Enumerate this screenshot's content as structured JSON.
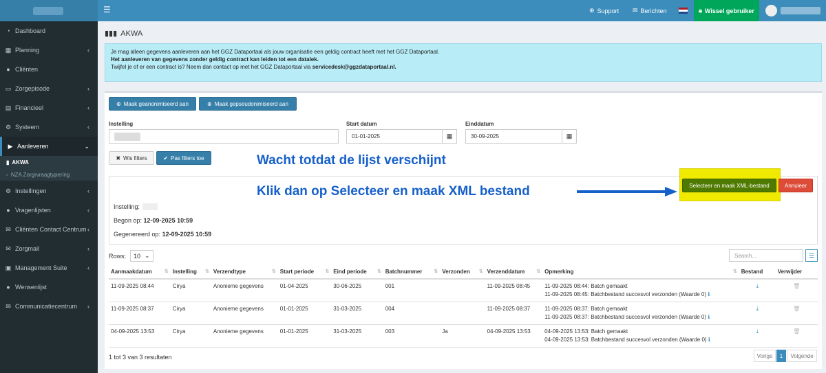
{
  "topbar": {
    "support": "Support",
    "messages": "Berichten",
    "switch_user": "Wissel gebruiker"
  },
  "sidebar": {
    "items": [
      {
        "label": "Dashboard",
        "icon": "dashboard-icon",
        "glyph": "◔"
      },
      {
        "label": "Planning",
        "icon": "calendar-icon",
        "glyph": "▦"
      },
      {
        "label": "Cliënten",
        "icon": "user-icon",
        "glyph": "●"
      },
      {
        "label": "Zorgepisode",
        "icon": "folder-icon",
        "glyph": "▭"
      },
      {
        "label": "Financieel",
        "icon": "money-icon",
        "glyph": "▤"
      },
      {
        "label": "Systeem",
        "icon": "gear-icon",
        "glyph": "⚙"
      },
      {
        "label": "Aanleveren",
        "icon": "truck-icon",
        "glyph": "▶"
      },
      {
        "label": "Instellingen",
        "icon": "cog-icon",
        "glyph": "⚙"
      },
      {
        "label": "Vragenlijsten",
        "icon": "comments-icon",
        "glyph": "●"
      },
      {
        "label": "Cliënten Contact Centrum",
        "icon": "envelope-icon",
        "glyph": "✉"
      },
      {
        "label": "Zorgmail",
        "icon": "mail-icon",
        "glyph": "✉"
      },
      {
        "label": "Management Suite",
        "icon": "briefcase-icon",
        "glyph": "▣"
      },
      {
        "label": "Wensenlijst",
        "icon": "star-icon",
        "glyph": "●"
      },
      {
        "label": "Communicatiecentrum",
        "icon": "inbox-icon",
        "glyph": "✉"
      }
    ],
    "sub": [
      "AKWA",
      "NZA Zorgrvraagtypering"
    ]
  },
  "page": {
    "title": "AKWA"
  },
  "alert": {
    "line1": "Je mag alleen gegevens aanleveren aan het GGZ Dataportaal als jouw organisatie een geldig contract heeft met het GGZ Dataportaal.",
    "line2": "Het aanleveren van gegevens zonder geldig contract kan leiden tot een datalek.",
    "line3_a": "Twijfel je of er een contract is? Neem dan contact op met het GGZ Dataportaal via ",
    "line3_b": "servicedesk@ggzdataportaal.nl."
  },
  "buttons": {
    "anon": "Maak geanonimiseerd aan",
    "pseudo": "Maak gepseudonimiseerd aan",
    "clear": "Wis filters",
    "apply": "Pas filters toe",
    "select_xml": "Selecteer en maak XML-bestand",
    "cancel": "Annuleer"
  },
  "filters": {
    "instelling_label": "Instelling",
    "start_label": "Start datum",
    "start_value": "01-01-2025",
    "end_label": "Einddatum",
    "end_value": "30-09-2025"
  },
  "info": {
    "instelling": "Instelling:",
    "begun_label": "Begon op: ",
    "begun_value": "12-09-2025 10:59",
    "gen_label": "Gegenereerd op: ",
    "gen_value": "12-09-2025 10:59"
  },
  "annotations": {
    "a1": "Wacht totdat de lijst verschijnt",
    "a2": "Klik dan op Selecteer en maak XML bestand"
  },
  "table": {
    "rows_label": "Rows:",
    "rows_value": "10",
    "search_placeholder": "Search...",
    "headers": [
      "Aanmaakdatum",
      "Instelling",
      "Verzendtype",
      "Start periode",
      "Eind periode",
      "Batchnummer",
      "Verzonden",
      "Verzenddatum",
      "Opmerking",
      "Bestand",
      "Verwijder"
    ],
    "rows": [
      [
        "11-09-2025 08:44",
        "Cirya",
        "Anonieme gegevens",
        "01-04-2025",
        "30-06-2025",
        "001",
        "",
        "11-09-2025 08:45",
        "11-09-2025 08:44: Batch gemaakt",
        "11-09-2025 08:45: Batchbestand succesvol verzonden (Waarde 0)"
      ],
      [
        "11-09-2025 08:37",
        "Cirya",
        "Anonieme gegevens",
        "01-01-2025",
        "31-03-2025",
        "004",
        "",
        "11-09-2025 08:37",
        "11-09-2025 08:37: Batch gemaakt",
        "11-09-2025 08:37: Batchbestand succesvol verzonden (Waarde 0)"
      ],
      [
        "04-09-2025 13:53",
        "Cirya",
        "Anonieme gegevens",
        "01-01-2025",
        "31-03-2025",
        "003",
        "Ja",
        "04-09-2025 13:53",
        "04-09-2025 13:53: Batch gemaakt",
        "04-09-2025 13:53: Batchbestand succesvol verzonden (Waarde 0)"
      ]
    ],
    "footer": "1 tot 3 van 3 resultaten"
  },
  "pagination": {
    "prev": "Vorige",
    "page": "1",
    "next": "Volgende"
  },
  "colors": {
    "topbar": "#3c8dbc",
    "sidebar": "#222d32",
    "green": "#00a65a",
    "alert": "#b8ecf7",
    "highlight": "#f0ea00",
    "annotation": "#1660c9"
  }
}
